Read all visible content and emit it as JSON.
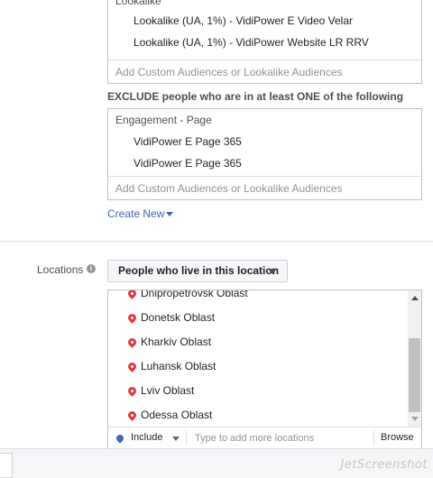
{
  "include_box": {
    "group_title": "Lookalike",
    "items": [
      "Lookalike (UA, 1%) - VidiPower E Video Velar",
      "Lookalike (UA, 1%) - VidiPower Website LR RRV"
    ],
    "input_placeholder": "Add Custom Audiences or Lookalike Audiences"
  },
  "exclude": {
    "label": "EXCLUDE people who are in at least ONE of the following",
    "group_title": "Engagement - Page",
    "items": [
      "VidiPower E Page 365",
      "VidiPower E Page 365"
    ],
    "input_placeholder": "Add Custom Audiences or Lookalike Audiences"
  },
  "create_new": "Create New",
  "locations": {
    "label": "Locations",
    "info_icon": "info-icon",
    "dropdown_value": "People who live in this location",
    "items": [
      "Dnipropetrovsk Oblast",
      "Donetsk Oblast",
      "Kharkiv Oblast",
      "Luhansk Oblast",
      "Lviv Oblast",
      "Odessa Oblast"
    ],
    "include_label": "Include",
    "search_placeholder": "Type to add more locations",
    "browse_label": "Browse"
  },
  "colors": {
    "link": "#4267b2",
    "pin": "#e0393e",
    "border": "#bec3c9"
  },
  "watermark": "JetScreenshot"
}
